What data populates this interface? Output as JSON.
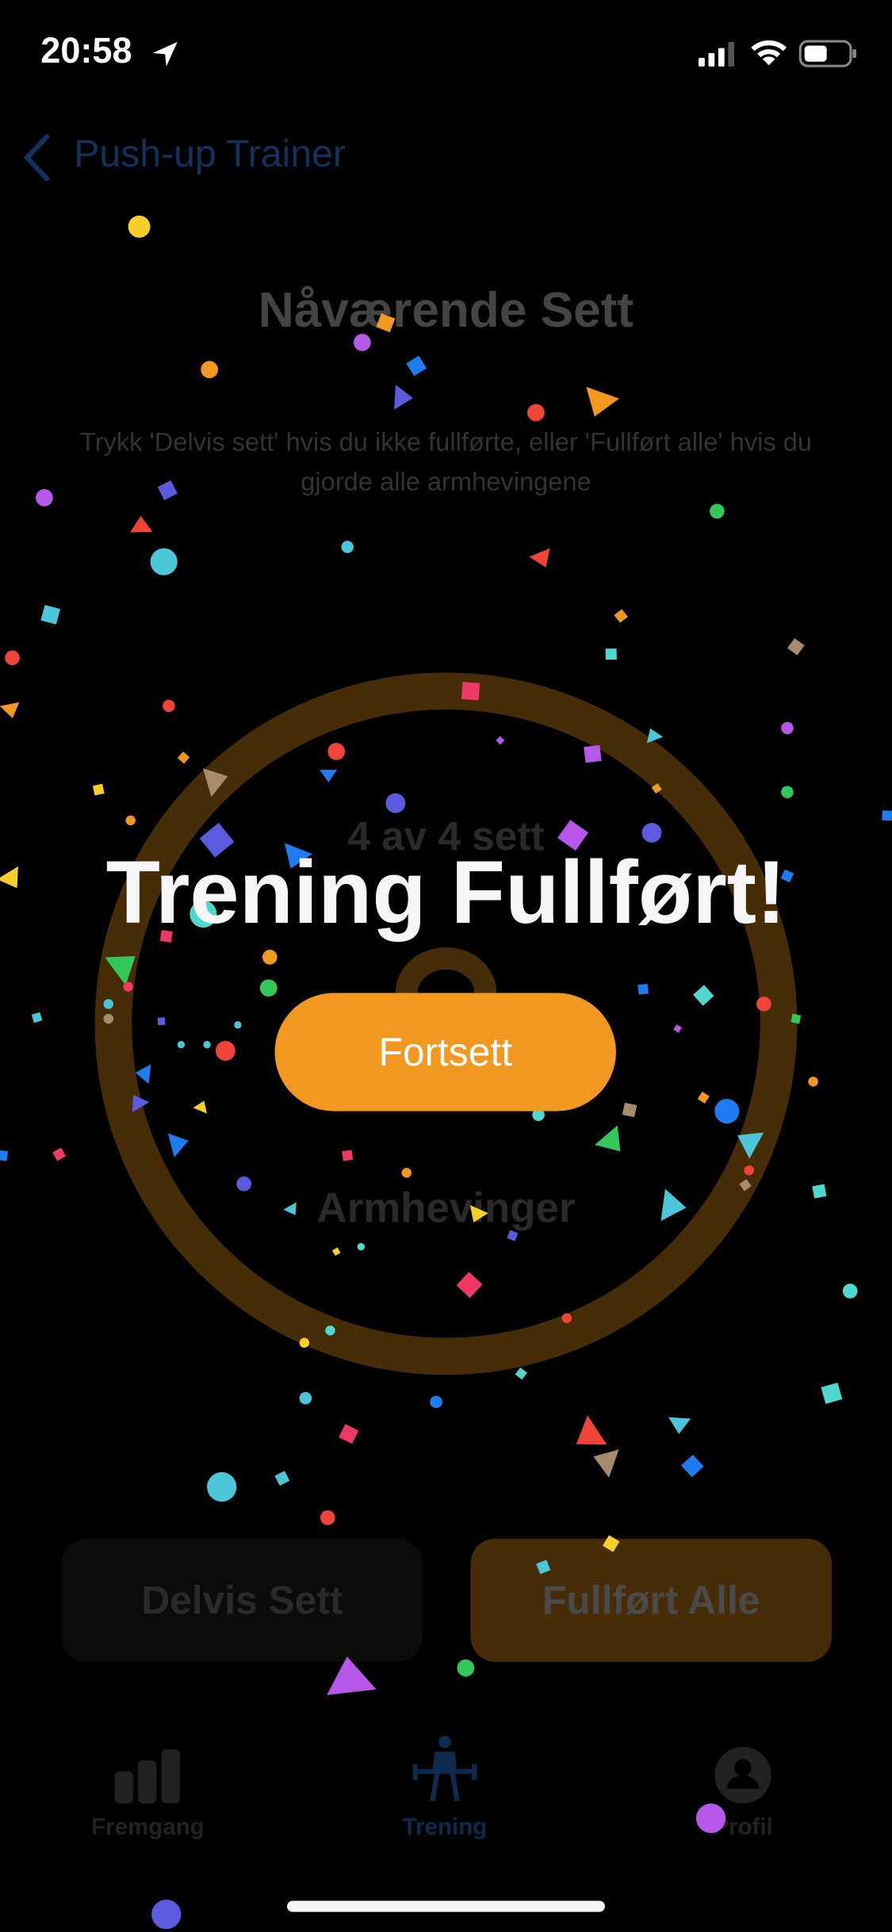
{
  "status_bar": {
    "time": "20:58"
  },
  "nav": {
    "back_label": "Push-up Trainer"
  },
  "main": {
    "heading": "Nåværende Sett",
    "instructions": "Trykk 'Delvis sett' hvis du ikke fullførte, eller 'Fullført alle' hvis du gjorde alle armhevingene",
    "sets_progress": "4 av 4 sett",
    "progress_fraction": 1.0,
    "unit_label": "Armhevinger",
    "partial_button": "Delvis Sett",
    "complete_button": "Fullført Alle"
  },
  "overlay": {
    "title": "Trening Fullført!",
    "continue_button": "Fortsett"
  },
  "tabs": [
    {
      "label": "Fremgang",
      "icon": "bar-chart-icon",
      "active": false
    },
    {
      "label": "Trening",
      "icon": "weightlifter-icon",
      "active": true
    },
    {
      "label": "Profil",
      "icon": "person-circle-icon",
      "active": false
    }
  ],
  "colors": {
    "accent": "#f0981f",
    "ring": "#472d07",
    "active_tab": "#0d2a4f",
    "confetti": [
      "#f04438",
      "#f0981f",
      "#f5d02a",
      "#34c759",
      "#4ac6d8",
      "#1e7cf0",
      "#5b5be0",
      "#b557e8",
      "#ee3a64",
      "#a88b6d",
      "#50d8cf"
    ]
  }
}
